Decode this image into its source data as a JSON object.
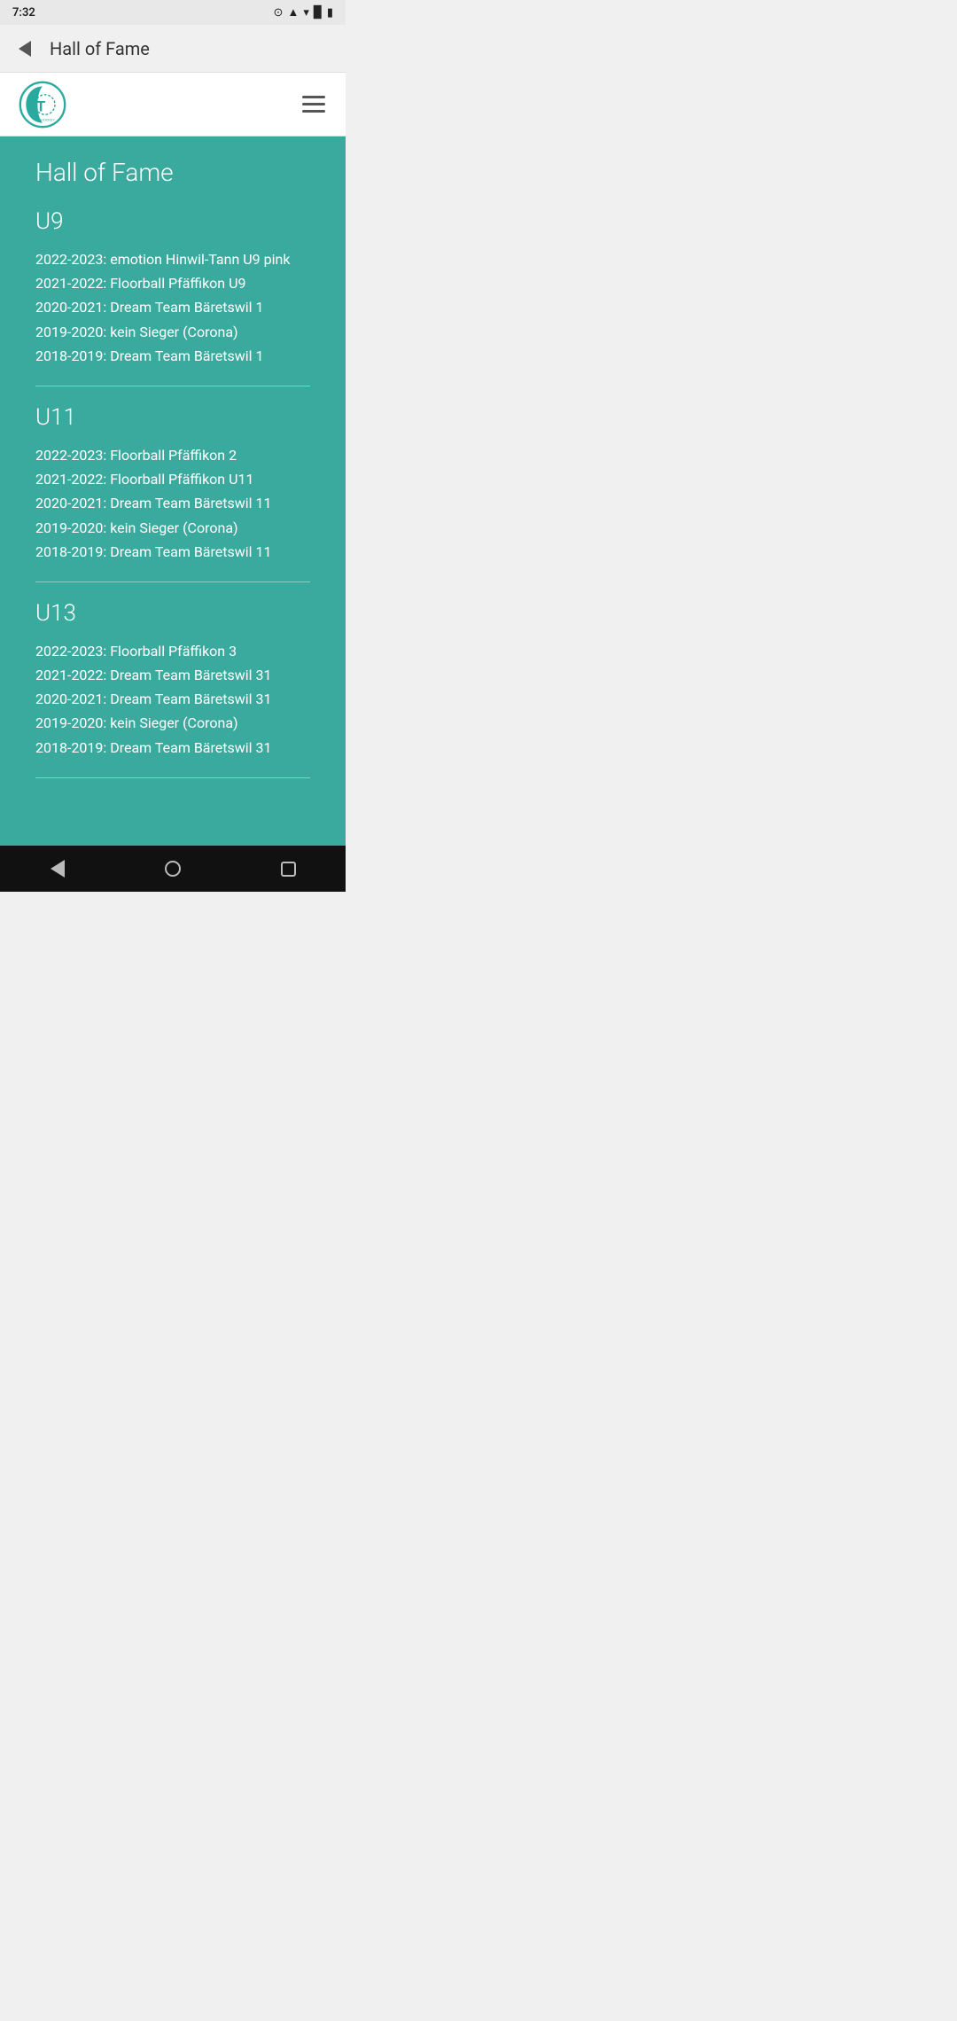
{
  "statusBar": {
    "time": "7:32",
    "icons": [
      "●",
      "▲",
      "▉"
    ]
  },
  "appBar": {
    "title": "Hall of Fame"
  },
  "pageTitle": "Hall of Fame",
  "categories": [
    {
      "id": "u9",
      "title": "U9",
      "entries": [
        "2022-2023: emotion Hinwil-Tann U9 pink",
        "2021-2022: Floorball Pfäffikon U9",
        "2020-2021: Dream Team Bäretswil 1",
        "2019-2020: kein Sieger (Corona)",
        "2018-2019: Dream Team Bäretswil 1"
      ]
    },
    {
      "id": "u11",
      "title": "U11",
      "entries": [
        "2022-2023: Floorball Pfäffikon 2",
        "2021-2022: Floorball Pfäffikon U11",
        "2020-2021: Dream Team Bäretswil 11",
        "2019-2020: kein Sieger (Corona)",
        "2018-2019: Dream Team Bäretswil 11"
      ]
    },
    {
      "id": "u13",
      "title": "U13",
      "entries": [
        "2022-2023: Floorball Pfäffikon 3",
        "2021-2022: Dream Team Bäretswil 31",
        "2020-2021: Dream Team Bäretswil 31",
        "2019-2020: kein Sieger (Corona)",
        "2018-2019: Dream Team Bäretswil 31"
      ]
    }
  ],
  "nav": {
    "back_label": "back",
    "menu_label": "menu"
  }
}
